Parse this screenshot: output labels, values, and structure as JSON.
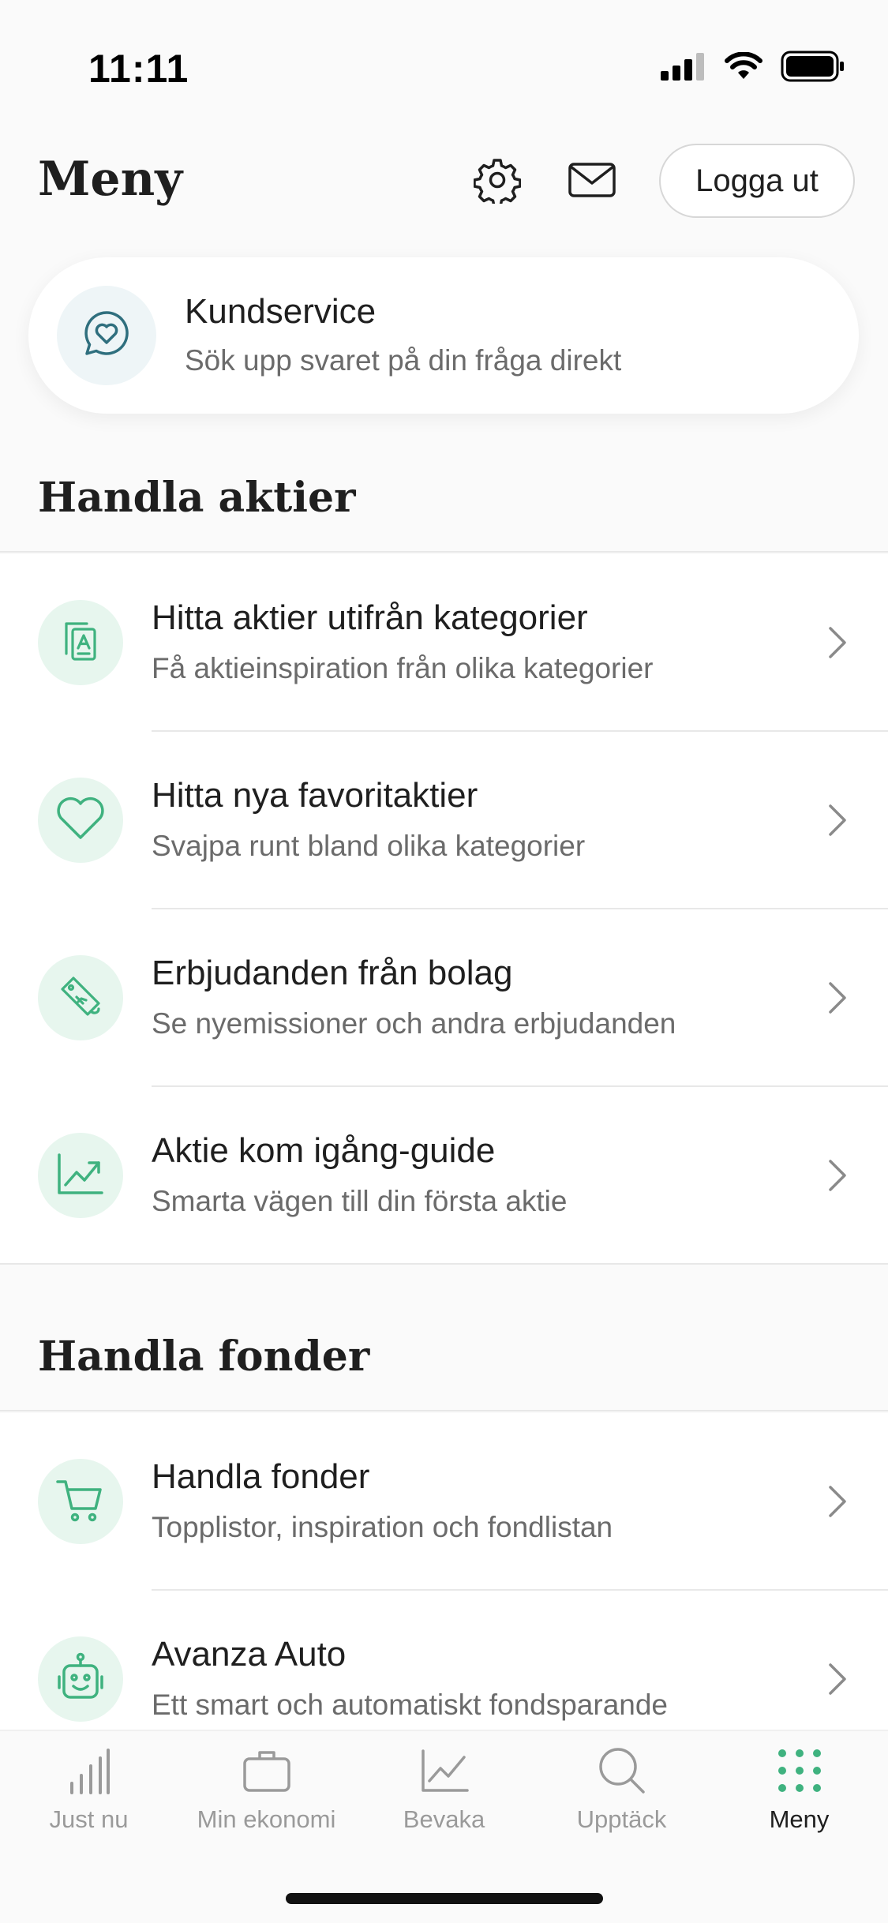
{
  "status_bar": {
    "time": "11:11"
  },
  "header": {
    "title": "Meny",
    "logout_label": "Logga ut"
  },
  "support": {
    "title": "Kundservice",
    "subtitle": "Sök upp svaret på din fråga direkt"
  },
  "sections": {
    "aktier": {
      "title": "Handla aktier",
      "items": [
        {
          "title": "Hitta aktier utifrån kategorier",
          "subtitle": "Få aktieinspiration från olika kategorier",
          "icon": "category-card-icon"
        },
        {
          "title": "Hitta nya favoritaktier",
          "subtitle": "Svajpa runt bland olika kategorier",
          "icon": "heart-icon"
        },
        {
          "title": "Erbjudanden från bolag",
          "subtitle": "Se nyemissioner och andra erbjudanden",
          "icon": "price-tag-icon"
        },
        {
          "title": "Aktie kom igång-guide",
          "subtitle": "Smarta vägen till din första aktie",
          "icon": "trend-chart-icon"
        }
      ]
    },
    "fonder": {
      "title": "Handla fonder",
      "items": [
        {
          "title": "Handla fonder",
          "subtitle": "Topplistor, inspiration och fondlistan",
          "icon": "shopping-cart-icon"
        },
        {
          "title": "Avanza Auto",
          "subtitle": "Ett smart och automatiskt fondsparande",
          "icon": "robot-icon"
        }
      ]
    }
  },
  "bottom_nav": {
    "items": [
      {
        "label": "Just nu",
        "icon": "bar-chart-icon"
      },
      {
        "label": "Min ekonomi",
        "icon": "briefcase-icon"
      },
      {
        "label": "Bevaka",
        "icon": "line-chart-icon"
      },
      {
        "label": "Upptäck",
        "icon": "search-icon"
      },
      {
        "label": "Meny",
        "icon": "grid-dots-icon"
      }
    ],
    "active": "Meny"
  },
  "colors": {
    "accent": "#3fb27f",
    "accent_bg": "#e7f6ee",
    "support_icon": "#2f6f7e",
    "text_primary": "#1f1f1f",
    "text_secondary": "#6b6b6b",
    "nav_inactive": "#9a9a9a"
  }
}
